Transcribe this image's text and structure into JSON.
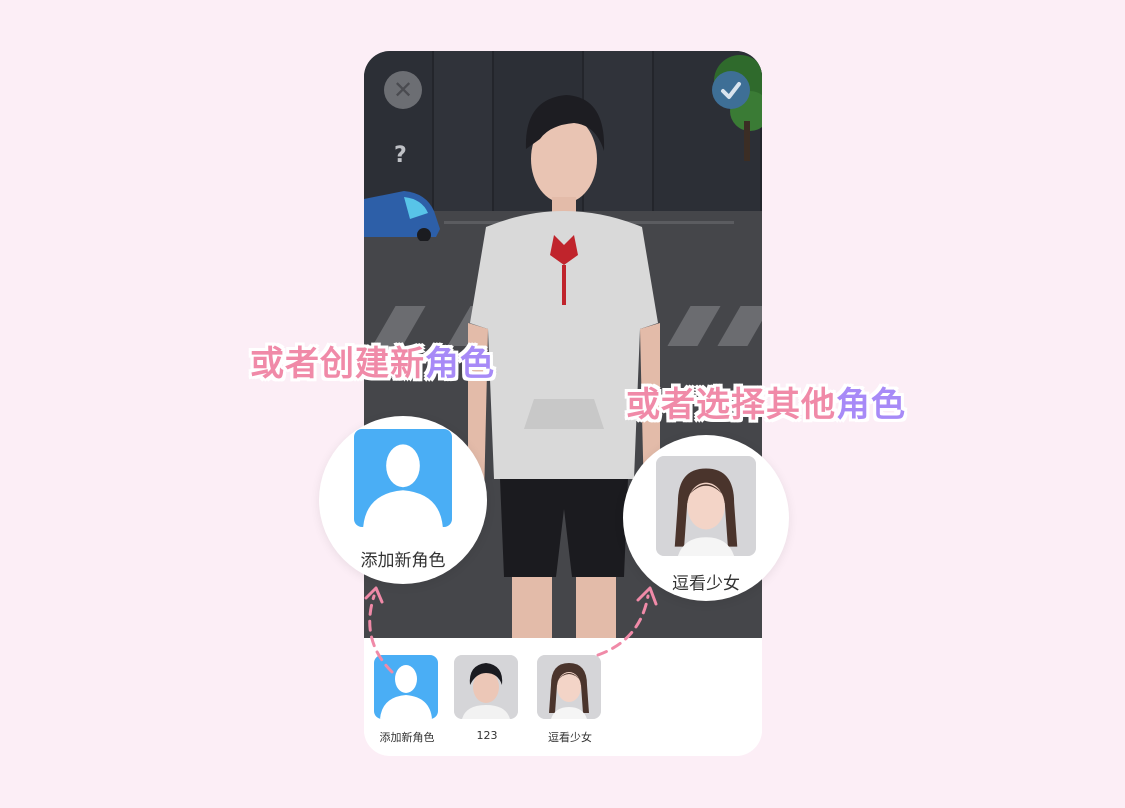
{
  "window": {
    "close_glyph": "✕",
    "confirm_icon": "check-icon",
    "hint_glyph": "?"
  },
  "callouts": {
    "create": {
      "part1": "或者创建新",
      "part2": "角色"
    },
    "select": {
      "part1": "或者选择其他",
      "part2": "角色"
    }
  },
  "bubbles": {
    "add": {
      "label": "添加新角色"
    },
    "girl": {
      "label": "逗看少女"
    }
  },
  "tray": {
    "items": [
      {
        "label": "添加新角色",
        "icon": "add-user-icon"
      },
      {
        "label": "123",
        "icon": "boy-avatar"
      },
      {
        "label": "逗看少女",
        "icon": "girl-avatar"
      }
    ]
  },
  "colors": {
    "background": "#fceef6",
    "callout_pink": "#f08aa8",
    "callout_violet": "#a78af7",
    "add_tile_blue": "#4aaef5",
    "confirm_blue": "#3e6f96"
  }
}
